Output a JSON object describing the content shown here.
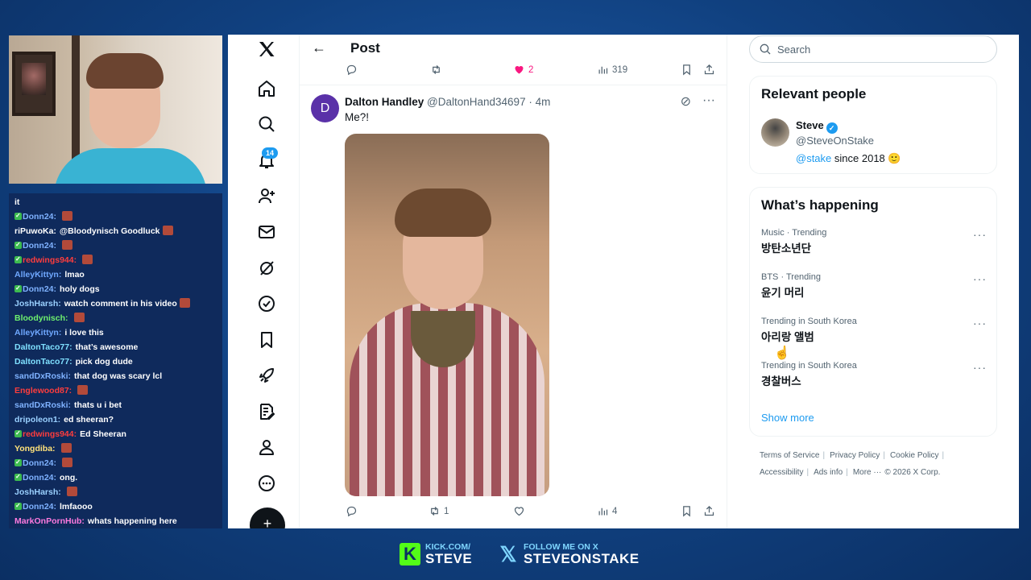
{
  "chat": {
    "messages": [
      {
        "verified": false,
        "user": "it",
        "user_color": "#ffffff",
        "text": "",
        "emote": false
      },
      {
        "verified": true,
        "user": "Donn24:",
        "user_color": "#7fb2ff",
        "text": "",
        "emote": true
      },
      {
        "verified": false,
        "user": "riPuwoKa:",
        "user_color": "#ffffff",
        "text": "@Bloodynisch Goodluck",
        "emote": true
      },
      {
        "verified": true,
        "user": "Donn24:",
        "user_color": "#7fb2ff",
        "text": "",
        "emote": true
      },
      {
        "verified": true,
        "user": "redwings944:",
        "user_color": "#ff3d3d",
        "text": "",
        "emote": true
      },
      {
        "verified": false,
        "user": "AlleyKittyn:",
        "user_color": "#6fa8ff",
        "text": "lmao",
        "emote": false
      },
      {
        "verified": true,
        "user": "Donn24:",
        "user_color": "#7fb2ff",
        "text": "holy dogs",
        "emote": false
      },
      {
        "verified": false,
        "user": "JoshHarsh:",
        "user_color": "#9ad0ff",
        "text": "watch comment in his video",
        "emote": true
      },
      {
        "verified": false,
        "user": "Bloodynisch:",
        "user_color": "#6ef06e",
        "text": "",
        "emote": true
      },
      {
        "verified": false,
        "user": "AlleyKittyn:",
        "user_color": "#6fa8ff",
        "text": "i love this",
        "emote": false
      },
      {
        "verified": false,
        "user": "DaltonTaco77:",
        "user_color": "#7fe0ff",
        "text": "that’s awesome",
        "emote": false
      },
      {
        "verified": false,
        "user": "DaltonTaco77:",
        "user_color": "#7fe0ff",
        "text": "pick dog dude",
        "emote": false
      },
      {
        "verified": false,
        "user": "sandDxRoski:",
        "user_color": "#7fb2ff",
        "text": "that dog was scary lcl",
        "emote": false
      },
      {
        "verified": false,
        "user": "Englewood87:",
        "user_color": "#ff3d3d",
        "text": "",
        "emote": true
      },
      {
        "verified": false,
        "user": "sandDxRoski:",
        "user_color": "#7fb2ff",
        "text": "thats u i bet",
        "emote": false
      },
      {
        "verified": false,
        "user": "dripoleon1:",
        "user_color": "#9ad0ff",
        "text": "ed sheeran?",
        "emote": false
      },
      {
        "verified": true,
        "user": "redwings944:",
        "user_color": "#ff3d3d",
        "text": "Ed Sheeran",
        "emote": false
      },
      {
        "verified": false,
        "user": "Yongdiba:",
        "user_color": "#ffe27a",
        "text": "",
        "emote": true
      },
      {
        "verified": true,
        "user": "Donn24:",
        "user_color": "#7fb2ff",
        "text": "",
        "emote": true
      },
      {
        "verified": true,
        "user": "Donn24:",
        "user_color": "#7fb2ff",
        "text": "ong.",
        "emote": false
      },
      {
        "verified": false,
        "user": "JoshHarsh:",
        "user_color": "#9ad0ff",
        "text": "",
        "emote": true
      },
      {
        "verified": true,
        "user": "Donn24:",
        "user_color": "#7fb2ff",
        "text": "lmfaooo",
        "emote": false
      },
      {
        "verified": false,
        "user": "MarkOnPornHub:",
        "user_color": "#ff7adf",
        "text": "whats happening here",
        "emote": false
      }
    ]
  },
  "nav": {
    "notifications_count": "14",
    "icons": [
      "x-logo-icon",
      "home-icon",
      "search-icon",
      "bell-icon",
      "people-add-icon",
      "mail-icon",
      "grok-icon",
      "verified-icon",
      "bookmark-icon",
      "rocket-icon",
      "article-icon",
      "profile-icon",
      "more-icon"
    ],
    "compose_label": "+"
  },
  "main": {
    "header_title": "Post",
    "prev_actions": {
      "likes": "2",
      "views": "319"
    },
    "tweet": {
      "avatar_letter": "D",
      "author_name": "Dalton Handley",
      "author_handle": "@DaltonHand34697",
      "time": "· 4m",
      "text": "Me?!",
      "retweets": "1",
      "views": "4"
    }
  },
  "search": {
    "placeholder": "Search"
  },
  "relevant_people": {
    "title": "Relevant people",
    "name": "Steve",
    "handle": "@SteveOnStake",
    "bio_link": "@stake",
    "bio_rest": "since 2018 🙂"
  },
  "happening": {
    "title": "What’s happening",
    "trends": [
      {
        "meta": "Music · Trending",
        "topic": "방탄소년단"
      },
      {
        "meta": "BTS · Trending",
        "topic": "윤기 머리"
      },
      {
        "meta": "Trending in South Korea",
        "topic": "아리랑 앨범"
      },
      {
        "meta": "Trending in South Korea",
        "topic": "경찰버스"
      }
    ],
    "show_more": "Show more"
  },
  "footer": {
    "line1": [
      "Terms of Service",
      "Privacy Policy",
      "Cookie Policy"
    ],
    "line2": [
      "Accessibility",
      "Ads info",
      "More ···",
      "© 2026 X Corp."
    ]
  },
  "promo": {
    "kick_small": "KICK.COM/",
    "kick_big": "STEVE",
    "x_small": "FOLLOW ME ON X",
    "x_big": "STEVEONSTAKE",
    "kick_color": "#53fc18",
    "accent_color": "#7fd6ff"
  },
  "colors": {
    "x_blue": "#1d9bf0",
    "like_pink": "#f91880"
  }
}
